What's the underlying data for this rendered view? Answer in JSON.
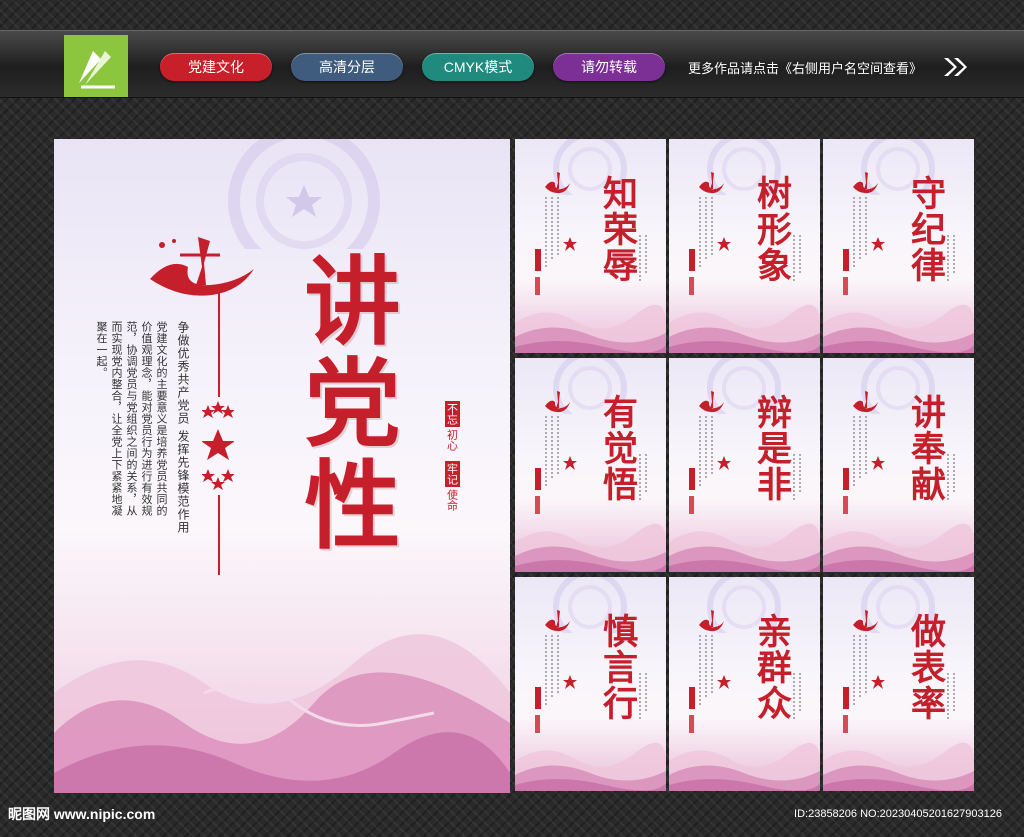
{
  "topbar": {
    "tags": [
      {
        "label": "党建文化",
        "color": "#c8202b"
      },
      {
        "label": "高清分层",
        "color": "#3f5b7d"
      },
      {
        "label": "CMYK模式",
        "color": "#1f8a7d"
      },
      {
        "label": "请勿转载",
        "color": "#7c2f94"
      }
    ],
    "more_text": "更多作品请点击《右侧用户名空间查看》"
  },
  "main_poster": {
    "title": "讲党性",
    "slogan": "争做优秀共产党员 发挥先锋模范作用",
    "description": "党建文化的主要意义是培养党员共同的价值观理念，能对党员行为进行有效规范，协调党员与党组织之间的关系，从而实现党内整合，让全党上下紧紧地凝聚在一起。",
    "badge_1": {
      "head": "不忘",
      "tail": "初心"
    },
    "badge_2": {
      "head": "牢记",
      "tail": "使命"
    }
  },
  "cards": [
    {
      "title": "知荣辱"
    },
    {
      "title": "树形象"
    },
    {
      "title": "守纪律"
    },
    {
      "title": "有觉悟"
    },
    {
      "title": "辩是非"
    },
    {
      "title": "讲奉献"
    },
    {
      "title": "慎言行"
    },
    {
      "title": "亲群众"
    },
    {
      "title": "做表率"
    }
  ],
  "footer": {
    "brand": "昵图网 www.nipic.com",
    "id_text": "ID:23858206 NO:20230405201627903126"
  },
  "colors": {
    "accent_red": "#c41f2a",
    "logo_green": "#8cc63f"
  }
}
